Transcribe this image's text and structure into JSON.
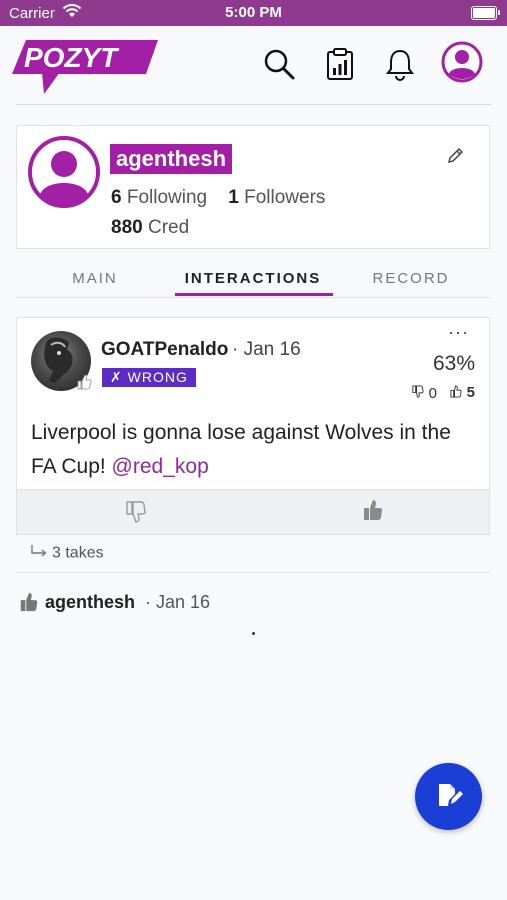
{
  "status_bar": {
    "carrier": "Carrier",
    "time": "5:00 PM"
  },
  "header": {
    "logo_text": "POZYT",
    "icons": [
      "search-icon",
      "leaderboard-icon",
      "bell-icon",
      "profile-icon"
    ],
    "brand_color": "#a31fa5"
  },
  "profile": {
    "username": "agenthesh",
    "following_count": "6",
    "following_label": "Following",
    "followers_count": "1",
    "followers_label": "Followers",
    "cred_count": "880",
    "cred_label": "Cred"
  },
  "tabs": [
    {
      "label": "MAIN",
      "active": false
    },
    {
      "label": "INTERACTIONS",
      "active": true
    },
    {
      "label": "RECORD",
      "active": false
    }
  ],
  "post": {
    "author": "GOATPenaldo",
    "date": "· Jan 16",
    "badge": "✗ WRONG",
    "percent": "63%",
    "down_votes": "0",
    "up_votes": "5",
    "text": "Liverpool is gonna lose against Wolves in the FA Cup! ",
    "mention": "@red_kop",
    "takes": "3 takes"
  },
  "activity": {
    "actor": "agenthesh",
    "date": "· Jan 16"
  },
  "colors": {
    "status_bar": "#8e3b8f",
    "accent": "#a31fa5",
    "wrong_badge": "#5b2bc6",
    "fab": "#1b3fd6"
  }
}
